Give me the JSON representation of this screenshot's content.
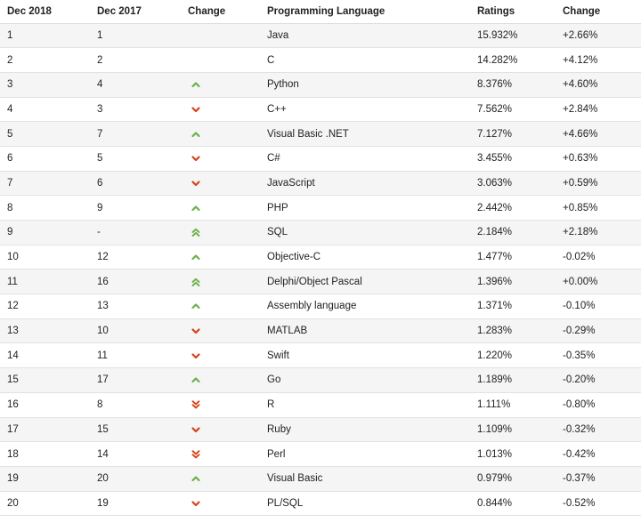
{
  "headers": [
    "Dec 2018",
    "Dec 2017",
    "Change",
    "Programming Language",
    "Ratings",
    "Change"
  ],
  "colors": {
    "up": "#6ab04c",
    "down": "#d64218"
  },
  "rows": [
    {
      "rank2018": "1",
      "rank2017": "1",
      "trend": "none",
      "language": "Java",
      "rating": "15.932%",
      "change": "+2.66%"
    },
    {
      "rank2018": "2",
      "rank2017": "2",
      "trend": "none",
      "language": "C",
      "rating": "14.282%",
      "change": "+4.12%"
    },
    {
      "rank2018": "3",
      "rank2017": "4",
      "trend": "up",
      "language": "Python",
      "rating": "8.376%",
      "change": "+4.60%"
    },
    {
      "rank2018": "4",
      "rank2017": "3",
      "trend": "down",
      "language": "C++",
      "rating": "7.562%",
      "change": "+2.84%"
    },
    {
      "rank2018": "5",
      "rank2017": "7",
      "trend": "up",
      "language": "Visual Basic .NET",
      "rating": "7.127%",
      "change": "+4.66%"
    },
    {
      "rank2018": "6",
      "rank2017": "5",
      "trend": "down",
      "language": "C#",
      "rating": "3.455%",
      "change": "+0.63%"
    },
    {
      "rank2018": "7",
      "rank2017": "6",
      "trend": "down",
      "language": "JavaScript",
      "rating": "3.063%",
      "change": "+0.59%"
    },
    {
      "rank2018": "8",
      "rank2017": "9",
      "trend": "up",
      "language": "PHP",
      "rating": "2.442%",
      "change": "+0.85%"
    },
    {
      "rank2018": "9",
      "rank2017": "-",
      "trend": "up2",
      "language": "SQL",
      "rating": "2.184%",
      "change": "+2.18%"
    },
    {
      "rank2018": "10",
      "rank2017": "12",
      "trend": "up",
      "language": "Objective-C",
      "rating": "1.477%",
      "change": "-0.02%"
    },
    {
      "rank2018": "11",
      "rank2017": "16",
      "trend": "up2",
      "language": "Delphi/Object Pascal",
      "rating": "1.396%",
      "change": "+0.00%"
    },
    {
      "rank2018": "12",
      "rank2017": "13",
      "trend": "up",
      "language": "Assembly language",
      "rating": "1.371%",
      "change": "-0.10%"
    },
    {
      "rank2018": "13",
      "rank2017": "10",
      "trend": "down",
      "language": "MATLAB",
      "rating": "1.283%",
      "change": "-0.29%"
    },
    {
      "rank2018": "14",
      "rank2017": "11",
      "trend": "down",
      "language": "Swift",
      "rating": "1.220%",
      "change": "-0.35%"
    },
    {
      "rank2018": "15",
      "rank2017": "17",
      "trend": "up",
      "language": "Go",
      "rating": "1.189%",
      "change": "-0.20%"
    },
    {
      "rank2018": "16",
      "rank2017": "8",
      "trend": "down2",
      "language": "R",
      "rating": "1.111%",
      "change": "-0.80%"
    },
    {
      "rank2018": "17",
      "rank2017": "15",
      "trend": "down",
      "language": "Ruby",
      "rating": "1.109%",
      "change": "-0.32%"
    },
    {
      "rank2018": "18",
      "rank2017": "14",
      "trend": "down2",
      "language": "Perl",
      "rating": "1.013%",
      "change": "-0.42%"
    },
    {
      "rank2018": "19",
      "rank2017": "20",
      "trend": "up",
      "language": "Visual Basic",
      "rating": "0.979%",
      "change": "-0.37%"
    },
    {
      "rank2018": "20",
      "rank2017": "19",
      "trend": "down",
      "language": "PL/SQL",
      "rating": "0.844%",
      "change": "-0.52%"
    }
  ]
}
